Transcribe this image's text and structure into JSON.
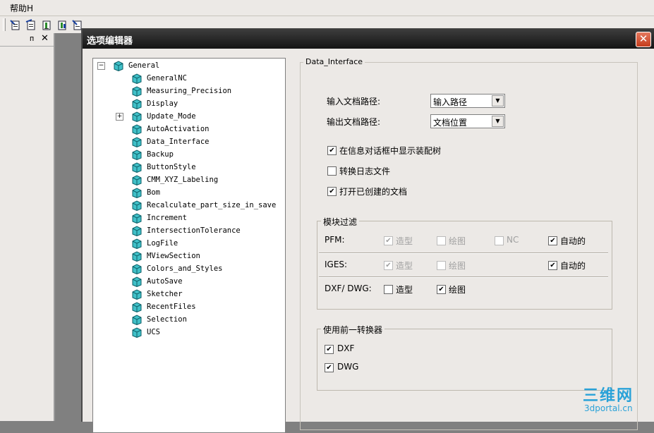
{
  "menubar": {
    "help": "帮助H"
  },
  "leftpane": {
    "pin": "ᴨ",
    "close": "✕"
  },
  "dialog": {
    "title": "选项编辑器",
    "close": "✕"
  },
  "tree": {
    "root": "General",
    "items": [
      "GeneralNC",
      "Measuring_Precision",
      "Display",
      "Update_Mode",
      "AutoActivation",
      "Data_Interface",
      "Backup",
      "ButtonStyle",
      "CMM_XYZ_Labeling",
      "Bom",
      "Recalculate_part_size_in_save",
      "Increment",
      "IntersectionTolerance",
      "LogFile",
      "MViewSection",
      "Colors_and_Styles",
      "AutoSave",
      "Sketcher",
      "RecentFiles",
      "Selection",
      "UCS"
    ],
    "expander_root": "−",
    "expander_update": "+"
  },
  "panel": {
    "title": "Data_Interface",
    "input_path_label": "输入文档路径:",
    "input_path_value": "输入路径",
    "output_path_label": "输出文档路径:",
    "output_path_value": "文档位置",
    "chk_show_assembly": "在信息对话框中显示装配树",
    "chk_convert_log": "转换日志文件",
    "chk_open_created": "打开已创建的文档",
    "module_filter": {
      "title": "模块过滤",
      "pfm": "PFM:",
      "iges": "IGES:",
      "dxf": "DXF/ DWG:",
      "modeling": "造型",
      "drawing": "绘图",
      "nc": "NC",
      "auto": "自动的"
    },
    "prev_converter": {
      "title": "使用前一转换器",
      "dxf": "DXF",
      "dwg": "DWG"
    }
  },
  "check_mark": "✔",
  "watermark": {
    "logo": "三维网",
    "url": "3dportal.cn"
  }
}
